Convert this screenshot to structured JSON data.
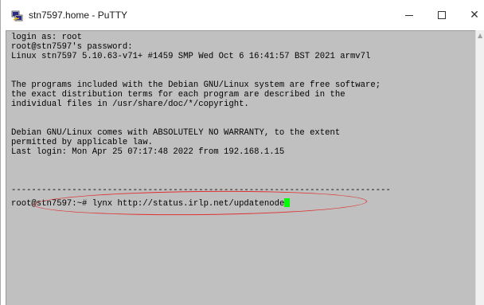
{
  "window": {
    "title": "stn7597.home - PuTTY",
    "icon": "putty-icon",
    "controls": {
      "minimize_icon": "minimize-icon",
      "maximize_icon": "maximize-icon",
      "close_icon": "close-icon",
      "close_glyph": "✕"
    }
  },
  "terminal": {
    "lines": [
      "login as: root",
      "root@stn7597's password:",
      "Linux stn7597 5.10.63-v71+ #1459 SMP Wed Oct 6 16:41:57 BST 2021 armv7l",
      "",
      "The programs included with the Debian GNU/Linux system are free software;",
      "the exact distribution terms for each program are described in the",
      "individual files in /usr/share/doc/*/copyright.",
      "",
      "Debian GNU/Linux comes with ABSOLUTELY NO WARRANTY, to the extent",
      "permitted by applicable law.",
      "Last login: Mon Apr 25 07:17:48 2022 from 192.168.1.15",
      "",
      "",
      "---------------------------------------------------------------------------"
    ],
    "prompt": "root@stn7597:~# ",
    "command": "lynx http://status.irlp.net/updatenode",
    "background_color": "#c0c0c0",
    "cursor_color": "#00ff00",
    "annotation_color": "#e03030"
  }
}
